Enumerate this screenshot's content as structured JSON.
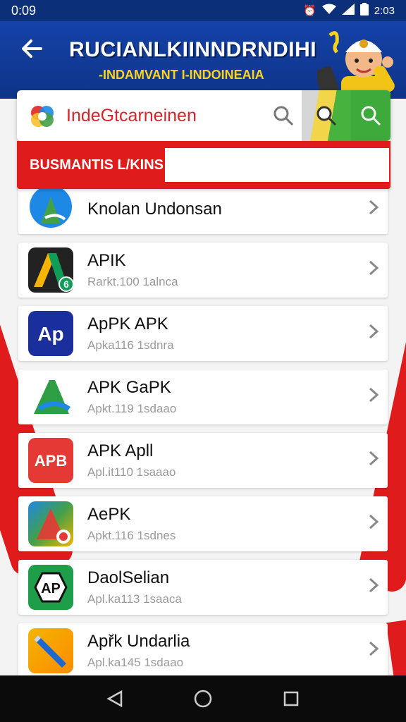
{
  "status_bar": {
    "time": "0:09",
    "clock_right": "2:03"
  },
  "header": {
    "title": "RUCIANLKIINNDRNDIHI",
    "subtitle": "-INDAMVANT I-INDOINEAIA"
  },
  "search": {
    "text": "IndeGtcarneinen"
  },
  "section": {
    "label": "BUSMANTIS L/KINS"
  },
  "apps": [
    {
      "name": "Knolan Undonsan",
      "sub": ""
    },
    {
      "name": "APIK",
      "sub": "Rarkt.100 1alnca"
    },
    {
      "name": "ApPK APK",
      "sub": "Apka116 1sdnra"
    },
    {
      "name": "APK GaPK",
      "sub": "Apkt.119 1sdaao"
    },
    {
      "name": "APK  Apll",
      "sub": "Apl.it110 1saaao"
    },
    {
      "name": "AePK",
      "sub": "Apkt.116 1sdnes"
    },
    {
      "name": "DaolSelian",
      "sub": "Apl.ka113 1saaca"
    },
    {
      "name": "Apřk Undarlia",
      "sub": "Apl.ka145 1sdaao"
    }
  ],
  "icons": {
    "back": "arrow-left-icon",
    "search": "search-icon",
    "chevron": "chevron-right-icon",
    "nav_back": "triangle-back-icon",
    "nav_home": "circle-home-icon",
    "nav_recents": "square-recents-icon"
  },
  "colors": {
    "header_blue": "#1442a8",
    "accent_red": "#e01b1b",
    "search_green": "#3daa3b",
    "title_yellow": "#ffd21a"
  }
}
